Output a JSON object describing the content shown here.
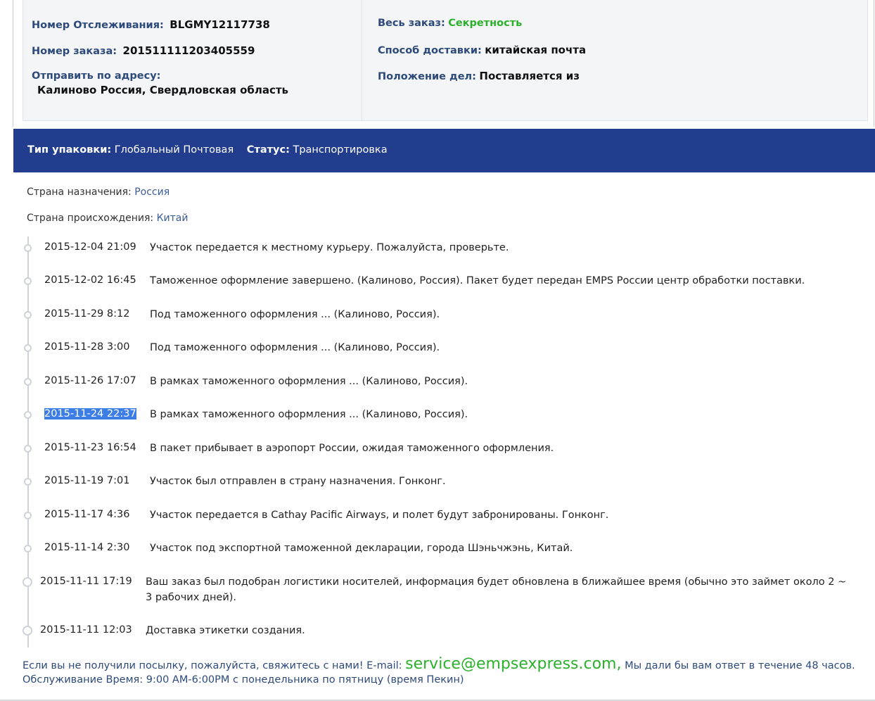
{
  "info": {
    "tracking_label": "Номер Отслеживания:",
    "tracking_value": "BLGMY12117738",
    "order_label": "Номер заказа:",
    "order_value": "201511111203405559",
    "address_label": "Отправить по адресу:",
    "address_value": "Калиново Россия, Свердловская область",
    "whole_order_label": "Весь заказ:",
    "whole_order_value": "Секретность",
    "delivery_label": "Способ доставки:",
    "delivery_value": "китайская почта",
    "status_label": "Положение дел:",
    "status_value": "Поставляется из"
  },
  "banner": {
    "package_label": "Тип упаковки:",
    "package_value": "Глобальный Почтовая",
    "status_label": "Статус:",
    "status_value": "Транспортировка"
  },
  "countries": {
    "dest_label": "Страна назначения:",
    "dest_value": "Россия",
    "origin_label": "Страна происхождения:",
    "origin_value": "Китай"
  },
  "events": [
    {
      "time": "2015-12-04 21:09",
      "desc": "Участок передается к местному курьеру. Пожалуйста, проверьте."
    },
    {
      "time": "2015-12-02 16:45",
      "desc": "Таможенное оформление завершено. (Калиново, Россия). Пакет будет передан EMPS России центр обработки поставки."
    },
    {
      "time": "2015-11-29 8:12",
      "desc": "Под таможенного оформления ... (Калиново, Россия)."
    },
    {
      "time": "2015-11-28 3:00",
      "desc": "Под таможенного оформления ... (Калиново, Россия)."
    },
    {
      "time": "2015-11-26 17:07",
      "desc": "В рамках таможенного оформления ... (Калиново, Россия)."
    },
    {
      "time": "2015-11-24 22:37",
      "desc": "В рамках таможенного оформления ... (Калиново, Россия)."
    },
    {
      "time": "2015-11-23 16:54",
      "desc": "В пакет прибывает в аэропорт России, ожидая таможенного оформления."
    },
    {
      "time": "2015-11-19 7:01",
      "desc": "Участок был отправлен в страну назначения. Гонконг."
    },
    {
      "time": "2015-11-17 4:36",
      "desc": "Участок передается в Cathay Pacific Airways, и полет будут забронированы. Гонконг."
    },
    {
      "time": "2015-11-14 2:30",
      "desc": "Участок под экспортной таможенной декларации, города Шэньчжэнь, Китай."
    },
    {
      "time": "2015-11-11 17:19",
      "desc": "Ваш заказ был подобран логистики носителей, информация будет обновлена в ближайшее время (обычно это займет около 2 ~ 3 рабочих дней)."
    },
    {
      "time": "2015-11-11 12:03",
      "desc": "Доставка этикетки создания."
    }
  ],
  "footer": {
    "text_before": "Если вы не получили посылку, пожалуйста, свяжитесь с нами! E-mail: ",
    "email": "service@empsexpress.com,",
    "text_after": " Мы дали бы вам ответ в течение 48 часов. Обслуживание Время: 9:00 AM-6:00PM с понедельника по пятницу (время Пекин)"
  },
  "colors": {
    "banner_bg": "#223d8e",
    "label_blue": "#2d4a7a",
    "accent_green": "#2bb02b",
    "selection_blue": "#3d7ee6"
  }
}
